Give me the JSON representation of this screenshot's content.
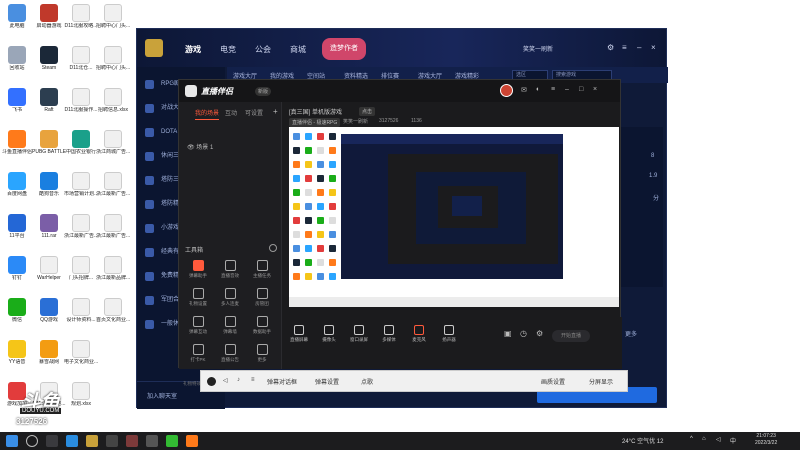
{
  "desktop": {
    "icons": [
      {
        "label": "此电脑",
        "color": "#4a8fe0"
      },
      {
        "label": "回收站",
        "color": "#9aa6b8"
      },
      {
        "label": "飞书",
        "color": "#3370ff"
      },
      {
        "label": "斗鱼直播伴侣",
        "color": "#ff7a1a"
      },
      {
        "label": "百度网盘",
        "color": "#2aa5ff"
      },
      {
        "label": "11平台",
        "color": "#2467d6"
      },
      {
        "label": "钉钉",
        "color": "#2b8af7"
      },
      {
        "label": "微信",
        "color": "#1aad19"
      },
      {
        "label": "YY语音",
        "color": "#f5c518"
      },
      {
        "label": "游戏加加",
        "color": "#e23c3c"
      },
      {
        "label": "启动器游戏",
        "color": "#c0392b"
      },
      {
        "label": "Steam",
        "color": "#1b2838"
      },
      {
        "label": "Raft",
        "color": "#2c3e50"
      },
      {
        "label": "PUBG BATTLEGR...",
        "color": "#e8a33d"
      },
      {
        "label": "酷狗音乐",
        "color": "#1a7fe0"
      },
      {
        "label": "111.rar",
        "color": "#7b5ea7"
      },
      {
        "label": "WarHelper",
        "color": "#f0f0f0"
      },
      {
        "label": "QQ游戏",
        "color": "#2a6fd6"
      },
      {
        "label": "暴雪战网",
        "color": "#f39c12"
      },
      {
        "label": "D11北服场地...",
        "color": "#f0f0f0"
      },
      {
        "label": "D11北服攻略...",
        "color": "#f0f0f0"
      },
      {
        "label": "D11北仓...",
        "color": "#f0f0f0"
      },
      {
        "label": "D11北服操作...",
        "color": "#f0f0f0"
      },
      {
        "label": "中国农业银行",
        "color": "#1aa08a"
      },
      {
        "label": "市场营销计划...",
        "color": "#f0f0f0"
      },
      {
        "label": "浙江最新广告...",
        "color": "#f0f0f0"
      },
      {
        "label": "门头招牌...",
        "color": "#f0f0f0"
      },
      {
        "label": "设计师资料...",
        "color": "#f0f0f0"
      },
      {
        "label": "电子文化商业...",
        "color": "#f0f0f0"
      },
      {
        "label": "规划.xlsx",
        "color": "#f0f0f0"
      },
      {
        "label": "招聘中心门头...",
        "color": "#f0f0f0"
      },
      {
        "label": "招聘中心门头...",
        "color": "#f0f0f0"
      },
      {
        "label": "招聘信息.xlsx",
        "color": "#f0f0f0"
      },
      {
        "label": "浙江商城广告...",
        "color": "#f0f0f0"
      },
      {
        "label": "浙江最新广告...",
        "color": "#f0f0f0"
      },
      {
        "label": "浙江最新广告...",
        "color": "#f0f0f0"
      },
      {
        "label": "浙江最新品牌...",
        "color": "#f0f0f0"
      },
      {
        "label": "首页文化商业...",
        "color": "#f0f0f0"
      }
    ]
  },
  "launcher": {
    "nav": [
      "游戏",
      "电竞",
      "公会",
      "商城"
    ],
    "promo": "造梦作者",
    "user": "笑笑一刷新",
    "subtabs": [
      "游戏大厅",
      "我的游戏",
      "空间站",
      "资料精选",
      "排位赛",
      "游戏大厅",
      "游戏精彩"
    ],
    "region_label": "选区",
    "search_placeholder": "搜索游戏",
    "sidebar_items": [
      "RPG剧情大厅",
      "对战大厅",
      "DOTA",
      "休闲三国",
      "塔防三国",
      "塔防精选",
      "小游戏",
      "经典有趣",
      "免费精选",
      "军团合击",
      "一般休闲"
    ],
    "friend_label": "加入聊天室",
    "right_values": [
      "8",
      "1.9",
      "分"
    ],
    "pink_label": "更多"
  },
  "companion": {
    "title": "直播伴侣",
    "version": "新版",
    "side_tabs": [
      "我的场景",
      "互动",
      "可设置"
    ],
    "scene_label": "场景 1",
    "tools_header": "工具箱",
    "tools": [
      {
        "label": "弹幕助手",
        "hot": true
      },
      {
        "label": "直播音效",
        "hot": false
      },
      {
        "label": "主播任务",
        "hot": false
      },
      {
        "label": "礼物设置",
        "hot": false
      },
      {
        "label": "多人连麦",
        "hot": false
      },
      {
        "label": "房管团",
        "hot": false
      },
      {
        "label": "弹幕互动",
        "hot": false
      },
      {
        "label": "弹幕墙",
        "hot": false
      },
      {
        "label": "数据助手",
        "hot": false
      },
      {
        "label": "打卡PK",
        "hot": false
      },
      {
        "label": "直播公告",
        "hot": false
      },
      {
        "label": "更多",
        "hot": false
      }
    ],
    "room_title": "[真三国] 单机版游戏",
    "room_tag": "点击",
    "room_meta1": "直播伴侣 - 极速RPG",
    "room_meta2": "笑笑一刷新",
    "room_id": "3127526",
    "room_count": "1136",
    "bottom_buttons": [
      "直播屏幕",
      "摄像头",
      "窗口录屏",
      "多媒体",
      "麦克风",
      "扬声器"
    ],
    "live_button": "开始直播",
    "footer": "礼物特效、顶部弹幕等 通知设置"
  },
  "strip": {
    "items": [
      "弹幕对话框",
      "弹幕设置",
      "点歌",
      "画质设置",
      "分屏显示"
    ]
  },
  "watermark": {
    "logo": "斗鱼",
    "sub": "DOUYU.COM",
    "room": "3127526"
  },
  "taskbar": {
    "weather": "24°C 空气优 12",
    "ime": "中",
    "time": "21:07:23",
    "date": "2022/3/22"
  }
}
